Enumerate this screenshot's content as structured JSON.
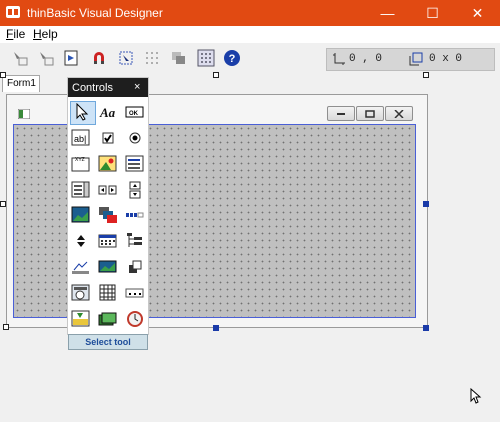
{
  "window": {
    "title": "thinBasic Visual Designer",
    "minimize_glyph": "—",
    "maximize_glyph": "☐",
    "close_glyph": "✕",
    "accent": "#e14a12"
  },
  "menu": {
    "file": {
      "accel": "F",
      "rest": "ile"
    },
    "help": {
      "accel": "H",
      "rest": "elp"
    }
  },
  "toolbar": {
    "icons": [
      "align-left-icon",
      "align-right-icon",
      "run-icon",
      "magnet-icon",
      "cursor-select-icon",
      "grid-icon",
      "send-back-icon",
      "grid-toggle-icon",
      "help-icon"
    ],
    "position": "0 , 0",
    "size": "0 x 0"
  },
  "form": {
    "tab_label": "Form1",
    "caption_buttons": [
      "minimize",
      "maximize",
      "close"
    ]
  },
  "palette": {
    "title": "Controls",
    "close_glyph": "×",
    "select_tool_label": "Select tool",
    "tools": [
      "pointer-icon",
      "label-icon",
      "button-icon",
      "textbox-icon",
      "checkbox-icon",
      "option-icon",
      "frame-icon",
      "image-icon",
      "listbox-icon",
      "combobox-icon",
      "hscroll-icon",
      "vscroll-icon",
      "picture-icon",
      "imagelist-icon",
      "progressbar-icon",
      "updown-icon",
      "calendar-icon",
      "treeview-icon",
      "statusbar-icon",
      "toolbar-icon",
      "rebar-icon",
      "datepicker-icon",
      "grid-icon",
      "ipaddress-icon",
      "trackbar-icon",
      "tab-icon",
      "timer-icon"
    ]
  }
}
